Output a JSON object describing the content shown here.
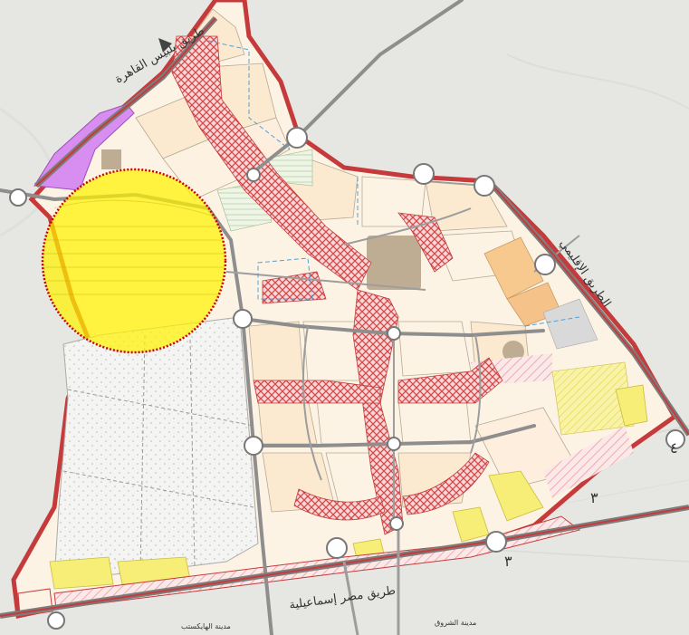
{
  "map": {
    "colors": {
      "background": "#e9e9e7",
      "residential": "#fbe9d0",
      "residential_light": "#fdf3e4",
      "services": "#f7c98f",
      "green": "#eaf3e2",
      "industrial": "#bfad93",
      "commercial": "#d78ef0",
      "education": "#f7ee77",
      "road_casing": "#c53b3b",
      "road": "#8e8e8e",
      "hatch_pink": "#f3c4c4",
      "highlight_fill": "#fff200",
      "highlight_border": "#cc0000"
    },
    "labels": {
      "road_cairo_belbeis": "طريق بلبيس القاهرة",
      "road_regional": "الطريق الإقليمي",
      "road_misr_ismailia": "طريق مصر إسماعيلية",
      "city_heliopolis": "مدينة الهايكستب",
      "city_shorouk": "مدينة الشروق"
    },
    "icons": {
      "interchange": "interchange-icon",
      "north_arrow": "north-arrow-icon"
    },
    "marker_numbers": {
      "m3a": "٣",
      "m3b": "٣",
      "m4": "٤"
    }
  }
}
